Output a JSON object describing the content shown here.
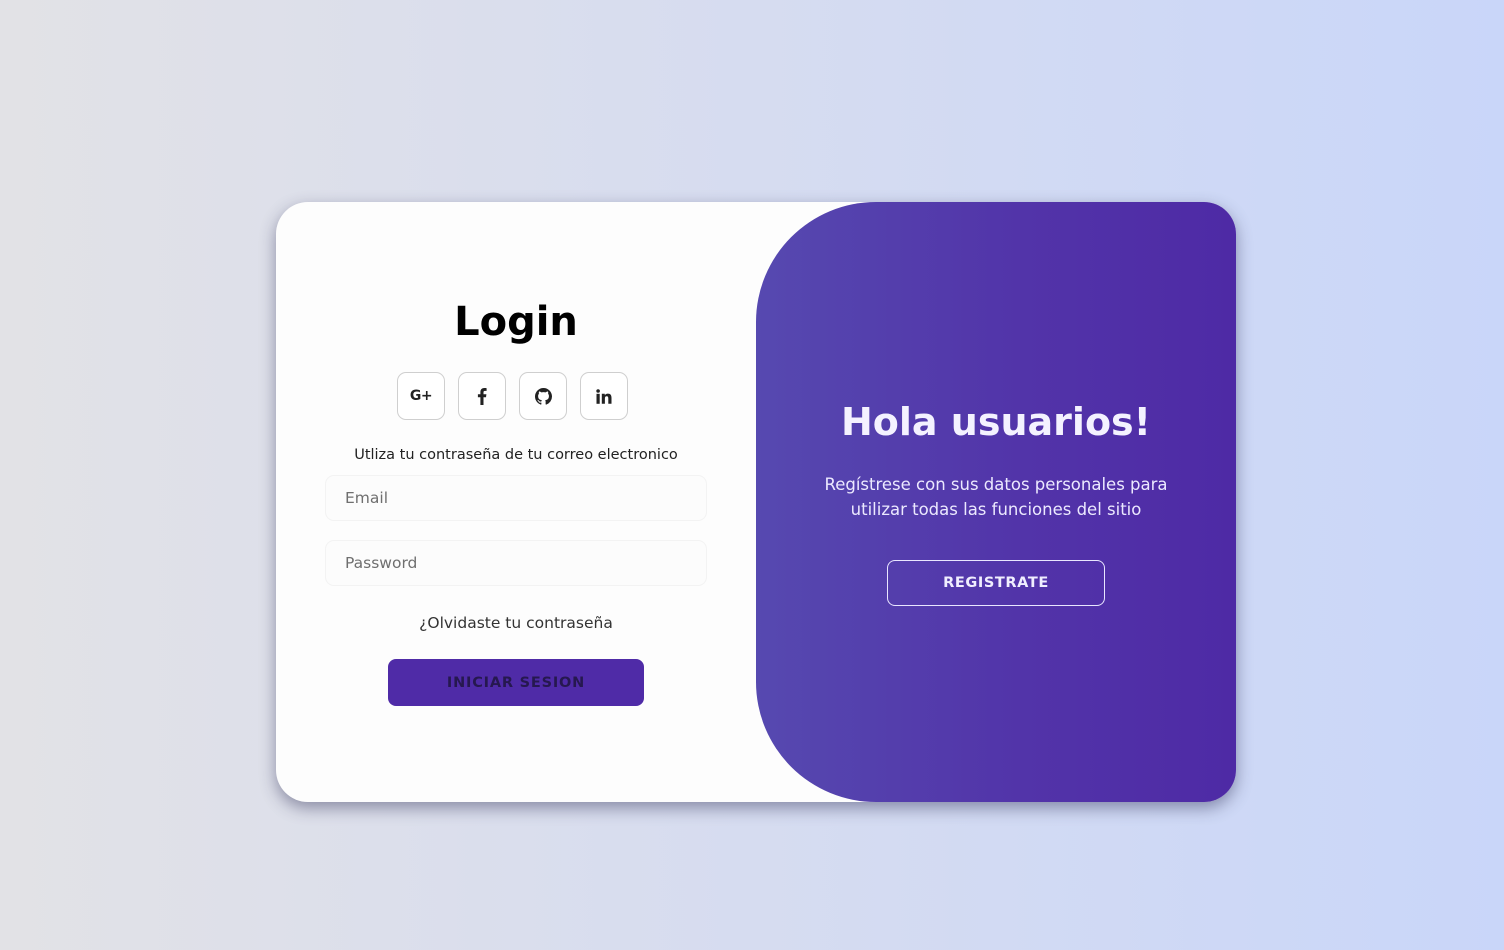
{
  "login": {
    "title": "Login",
    "social_buttons": [
      {
        "icon": "google-plus-icon",
        "label": "G+"
      },
      {
        "icon": "facebook-icon",
        "label": "f"
      },
      {
        "icon": "github-icon",
        "label": ""
      },
      {
        "icon": "linkedin-icon",
        "label": "in"
      }
    ],
    "helper_text": "Utliza tu contraseña de tu correo electronico",
    "email_placeholder": "Email",
    "password_placeholder": "Password",
    "forgot_link": "¿Olvidaste tu contraseña",
    "submit_label": "INICIAR SESION"
  },
  "welcome": {
    "title": "Hola usuarios!",
    "text": "Regístrese con sus datos personales para utilizar todas las funciones del sitio",
    "register_label": "REGISTRATE"
  },
  "colors": {
    "accent": "#4f2ba7",
    "panel_gradient_start": "#5649b0",
    "panel_gradient_end": "#4e2aa5",
    "background_left": "#e2e2e6",
    "background_right": "#c9d6f9"
  }
}
